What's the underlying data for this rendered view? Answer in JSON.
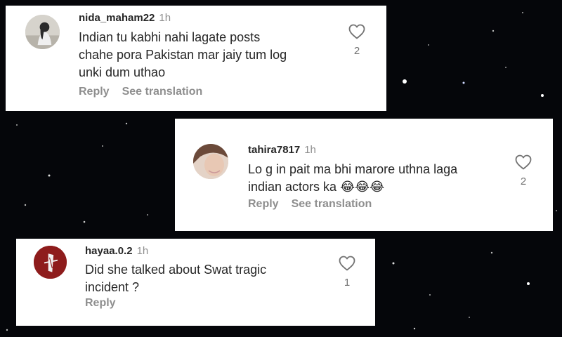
{
  "comments": [
    {
      "username": "nida_maham22",
      "time": "1h",
      "lines": [
        "Indian tu kabhi nahi lagate posts",
        "chahe pora Pakistan mar jaiy tum log",
        "unki dum uthao"
      ],
      "reply_label": "Reply",
      "translation_label": "See translation",
      "like_icon": "heart-icon",
      "likes": "2"
    },
    {
      "username": "tahira7817",
      "time": "1h",
      "lines": [
        "Lo g in pait ma bhi marore uthna laga",
        "indian actors ka 😂😂😂"
      ],
      "reply_label": "Reply",
      "translation_label": "See translation",
      "like_icon": "heart-icon",
      "likes": "2"
    },
    {
      "username": "hayaa.0.2",
      "time": "1h",
      "lines": [
        "Did she talked about Swat tragic",
        "incident ?"
      ],
      "reply_label": "Reply",
      "like_icon": "heart-icon",
      "likes": "1"
    }
  ],
  "colors": {
    "background": "#05060a",
    "card": "#ffffff",
    "username": "#262626",
    "muted": "#8e8e8e"
  }
}
